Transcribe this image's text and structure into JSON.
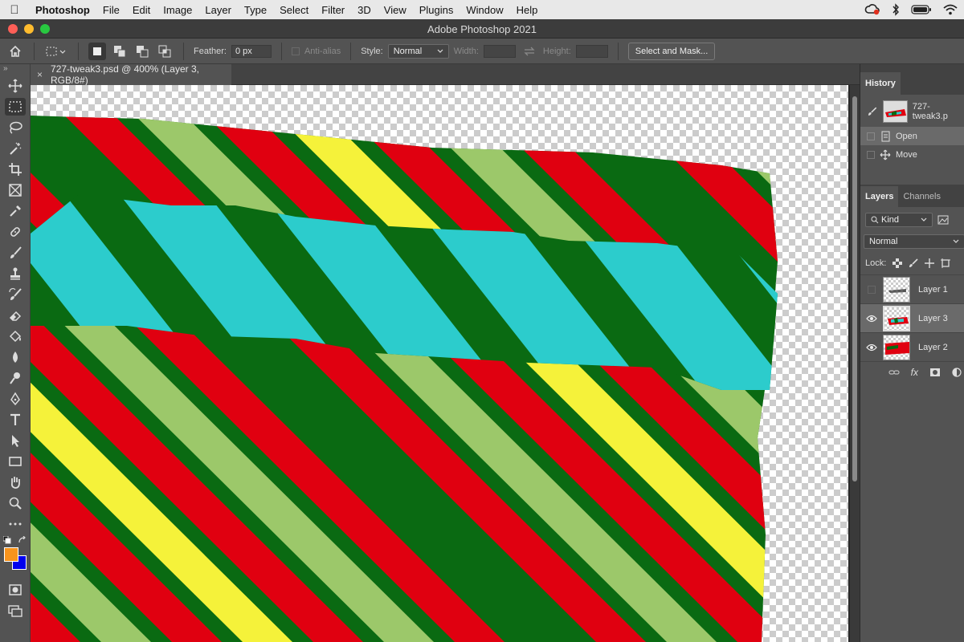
{
  "menubar": {
    "app_name": "Photoshop",
    "items": [
      "File",
      "Edit",
      "Image",
      "Layer",
      "Type",
      "Select",
      "Filter",
      "3D",
      "View",
      "Plugins",
      "Window",
      "Help"
    ]
  },
  "window": {
    "title": "Adobe Photoshop 2021"
  },
  "options_bar": {
    "feather_label": "Feather:",
    "feather_value": "0 px",
    "antialias_label": "Anti-alias",
    "style_label": "Style:",
    "style_value": "Normal",
    "width_label": "Width:",
    "height_label": "Height:",
    "select_mask_label": "Select and Mask..."
  },
  "document": {
    "tab_title": "727-tweak3.psd @ 400% (Layer 3, RGB/8#)"
  },
  "history": {
    "tab_label": "History",
    "snapshot_name": "727-tweak3.p",
    "steps": [
      {
        "label": "Open",
        "icon": "document-icon"
      },
      {
        "label": "Move",
        "icon": "move-icon"
      }
    ]
  },
  "layers": {
    "tabs": [
      "Layers",
      "Channels"
    ],
    "filter_label": "Kind",
    "blend_mode": "Normal",
    "lock_label": "Lock:",
    "items": [
      {
        "name": "Layer 1",
        "visible": false,
        "selected": false
      },
      {
        "name": "Layer 3",
        "visible": true,
        "selected": true
      },
      {
        "name": "Layer 2",
        "visible": true,
        "selected": false
      }
    ],
    "footer_fx": "fx"
  },
  "colors": {
    "foreground": "#f7941d",
    "background": "#0000ee",
    "stripe_red": "#e00010",
    "stripe_darkgreen": "#0a6a12",
    "stripe_lightgreen": "#9cc86a",
    "stripe_yellow": "#f5f23a",
    "stripe_cyan": "#2ccccc"
  },
  "icons": {
    "toolbox": [
      "move-tool-icon",
      "marquee-tool-icon",
      "lasso-tool-icon",
      "magic-wand-tool-icon",
      "crop-tool-icon",
      "frame-tool-icon",
      "eyedropper-tool-icon",
      "healing-brush-tool-icon",
      "brush-tool-icon",
      "clone-stamp-tool-icon",
      "history-brush-tool-icon",
      "eraser-tool-icon",
      "paint-bucket-tool-icon",
      "blur-tool-icon",
      "dodge-tool-icon",
      "pen-tool-icon",
      "type-tool-icon",
      "path-selection-tool-icon",
      "rectangle-tool-icon",
      "hand-tool-icon",
      "zoom-tool-icon",
      "more-tools-icon"
    ]
  }
}
